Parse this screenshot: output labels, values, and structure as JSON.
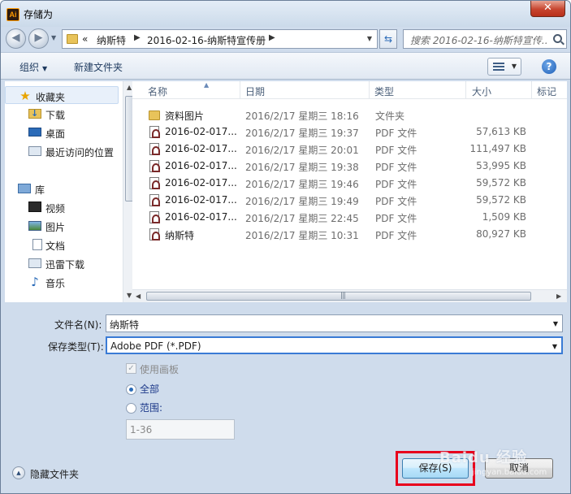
{
  "window": {
    "title": "存储为",
    "app_icon_text": "Ai",
    "close_label": "✕"
  },
  "address": {
    "back_icon": "back-arrow-icon",
    "forward_icon": "forward-arrow-icon",
    "overflow": "«",
    "crumbs": [
      "纳斯特",
      "2016-02-16-纳斯特宣传册"
    ]
  },
  "search": {
    "placeholder": "搜索 2016-02-16-纳斯特宣传..."
  },
  "toolbar": {
    "organize_label": "组织",
    "new_folder_label": "新建文件夹",
    "help_label": "?"
  },
  "nav": {
    "favorites": "收藏夹",
    "items_fav": [
      "下载",
      "桌面",
      "最近访问的位置"
    ],
    "library": "库",
    "items_lib": [
      "视频",
      "图片",
      "文档",
      "迅雷下载",
      "音乐"
    ]
  },
  "columns": {
    "name": "名称",
    "date": "日期",
    "type": "类型",
    "size": "大小",
    "tags": "标记"
  },
  "files": [
    {
      "name": "资料图片",
      "date": "2016/2/17 星期三 18:16",
      "type": "文件夹",
      "size": "",
      "kind": "folder"
    },
    {
      "name": "2016-02-017...",
      "date": "2016/2/17 星期三 19:37",
      "type": "PDF 文件",
      "size": "57,613 KB",
      "kind": "pdf"
    },
    {
      "name": "2016-02-017...",
      "date": "2016/2/17 星期三 20:01",
      "type": "PDF 文件",
      "size": "111,497 KB",
      "kind": "pdf"
    },
    {
      "name": "2016-02-017...",
      "date": "2016/2/17 星期三 19:38",
      "type": "PDF 文件",
      "size": "53,995 KB",
      "kind": "pdf"
    },
    {
      "name": "2016-02-017...",
      "date": "2016/2/17 星期三 19:46",
      "type": "PDF 文件",
      "size": "59,572 KB",
      "kind": "pdf"
    },
    {
      "name": "2016-02-017...",
      "date": "2016/2/17 星期三 19:49",
      "type": "PDF 文件",
      "size": "59,572 KB",
      "kind": "pdf"
    },
    {
      "name": "2016-02-017...",
      "date": "2016/2/17 星期三 22:45",
      "type": "PDF 文件",
      "size": "1,509 KB",
      "kind": "pdf"
    },
    {
      "name": "纳斯特",
      "date": "2016/2/17 星期三 10:31",
      "type": "PDF 文件",
      "size": "80,927 KB",
      "kind": "pdf"
    }
  ],
  "form": {
    "filename_label": "文件名(N):",
    "filename_value": "纳斯特",
    "filetype_label": "保存类型(T):",
    "filetype_value": "Adobe PDF (*.PDF)",
    "use_artboards": "使用画板",
    "all_label": "全部",
    "range_label": "范围:",
    "range_value": "1-36"
  },
  "footer": {
    "hide_folders": "隐藏文件夹",
    "save_label": "保存(S)",
    "cancel_label": "取消",
    "watermark": "Baidu 经验",
    "watermark_sub": "jingyan.baidu.com"
  },
  "colors": {
    "highlight": "#e8001c",
    "titlebar": "#cbdaea"
  }
}
